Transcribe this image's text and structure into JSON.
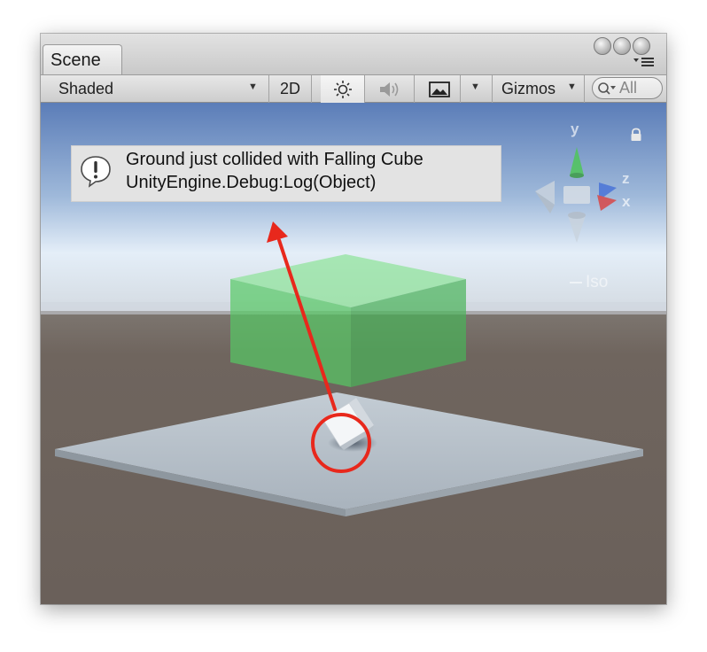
{
  "window": {
    "tab_label": "Scene"
  },
  "toolbar": {
    "shading_mode": "Shaded",
    "mode_2d": "2D",
    "lighting_icon": "sun-icon",
    "audio_icon": "speaker-icon",
    "effects_icon": "image-icon",
    "gizmos_label": "Gizmos",
    "search_placeholder": "All"
  },
  "console_message": {
    "line1": "Ground just collided with Falling Cube",
    "line2": "UnityEngine.Debug:Log(Object)"
  },
  "orientation_gizmo": {
    "axis_y": "y",
    "axis_z": "z",
    "axis_x": "x",
    "projection": "Iso"
  },
  "colors": {
    "sky_top": "#5b7db8",
    "horizon": "#e4eef8",
    "ground": "#6f655e",
    "plane": "#b7c2cd",
    "trigger_box": "#5fd46f",
    "annotation": "#e8281c"
  }
}
